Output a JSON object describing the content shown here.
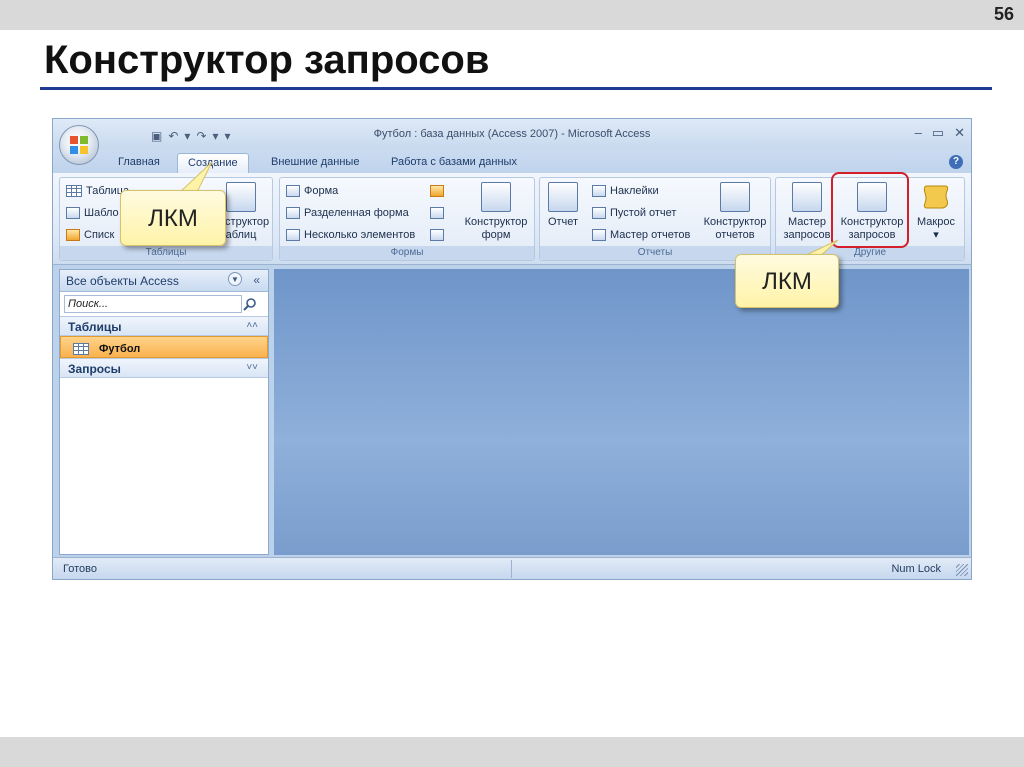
{
  "slide": {
    "number": "56",
    "title": "Конструктор запросов"
  },
  "window": {
    "title": "Футбол : база данных (Access 2007) - Microsoft Access",
    "controls": {
      "minimize": "–",
      "maximize": "▭",
      "close": "✕"
    }
  },
  "tabs": [
    {
      "label": "Главная"
    },
    {
      "label": "Создание"
    },
    {
      "label": "Внешние данные"
    },
    {
      "label": "Работа с базами данных"
    }
  ],
  "ribbon": {
    "tables": {
      "label": "Таблицы",
      "table": "Таблица",
      "templates": "Шабло",
      "lists": "Списк",
      "designer_line1": "онструктор",
      "designer_line2": "аблиц"
    },
    "forms": {
      "label": "Формы",
      "form": "Форма",
      "split_form": "Разделенная форма",
      "multiple_items": "Несколько элементов",
      "designer_line1": "Конструктор",
      "designer_line2": "форм"
    },
    "reports": {
      "label": "Отчеты",
      "report": "Отчет",
      "labels": "Наклейки",
      "blank_report": "Пустой отчет",
      "report_wizard": "Мастер отчетов",
      "designer_line1": "Конструктор",
      "designer_line2": "отчетов"
    },
    "other": {
      "label": "Другие",
      "query_wizard_line1": "Мастер",
      "query_wizard_line2": "запросов",
      "query_designer_line1": "Конструктор",
      "query_designer_line2": "запросов",
      "macro": "Макрос",
      "macro_arrow": "▾"
    }
  },
  "nav": {
    "header": "Все объекты Access",
    "search_placeholder": "Поиск...",
    "sections": [
      {
        "label": "Таблицы",
        "arrow": "≈"
      },
      {
        "label": "Запросы",
        "arrow": "≈"
      }
    ],
    "items": [
      {
        "label": "Футбол"
      }
    ]
  },
  "status": {
    "left": "Готово",
    "right": "Num Lock"
  },
  "callouts": [
    {
      "text": "ЛКМ"
    },
    {
      "text": "ЛКМ"
    }
  ],
  "colors": {
    "accent_rule": "#1f3a93",
    "highlight": "#d21f2a",
    "selected_item": "#f9b24f"
  }
}
